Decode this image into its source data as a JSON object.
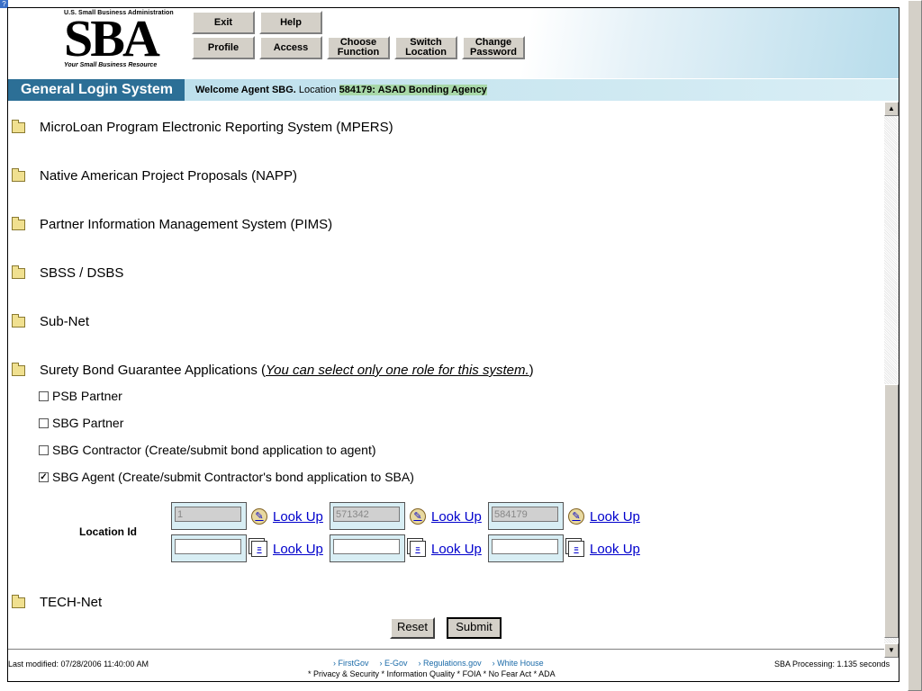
{
  "corner_icon": "?",
  "logo": {
    "org_name": "U.S. Small Business Administration",
    "letters": "SBA",
    "tagline": "Your Small Business Resource"
  },
  "toolbar": {
    "exit": "Exit",
    "help": "Help",
    "profile": "Profile",
    "access": "Access",
    "choose_function": "Choose Function",
    "switch_location": "Switch Location",
    "change_password": "Change Password"
  },
  "titlebar": {
    "system_name": "General Login System",
    "welcome_prefix": "Welcome Agent SBG.",
    "location_label": "Location",
    "location_value": "584179: ASAD Bonding Agency"
  },
  "systems": [
    {
      "label": "MicroLoan Program Electronic Reporting System (MPERS)"
    },
    {
      "label": "Native American Project Proposals (NAPP)"
    },
    {
      "label": "Partner Information Management System (PIMS)"
    },
    {
      "label": "SBSS / DSBS"
    },
    {
      "label": "Sub-Net"
    },
    {
      "label": "Surety Bond Guarantee Applications (",
      "note": "You can select only one role for this system.",
      "suffix": ")"
    },
    {
      "label": "TECH-Net"
    }
  ],
  "roles": [
    {
      "label": "PSB Partner",
      "checked": false
    },
    {
      "label": "SBG Partner",
      "checked": false
    },
    {
      "label": "SBG Contractor (Create/submit bond application to agent)",
      "checked": false
    },
    {
      "label": "SBG Agent (Create/submit Contractor's bond application to SBA)",
      "checked": true
    }
  ],
  "location": {
    "label": "Location Id",
    "lookup_label": "Look Up",
    "row1": [
      "1",
      "571342",
      "584179"
    ],
    "row2": [
      "",
      "",
      ""
    ]
  },
  "form": {
    "reset": "Reset",
    "submit": "Submit"
  },
  "footer": {
    "last_modified": "Last modified: 07/28/2006 11:40:00 AM",
    "links": [
      "FirstGov",
      "E-Gov",
      "Regulations.gov",
      "White House"
    ],
    "links2": "* Privacy & Security  * Information Quality  * FOIA  * No Fear Act  * ADA",
    "processing": "SBA Processing:  1.135 seconds"
  },
  "scroll": {
    "up": "▲",
    "down": "▼"
  }
}
